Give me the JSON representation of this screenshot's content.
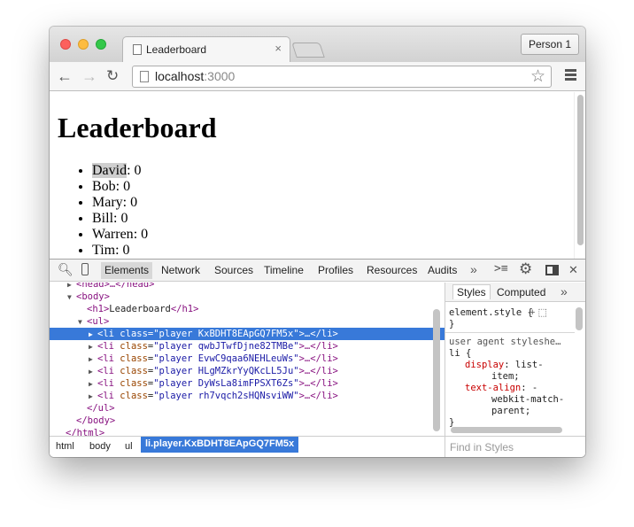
{
  "tab": {
    "title": "Leaderboard",
    "close": "×"
  },
  "profile": "Person 1",
  "omnibox": {
    "host": "localhost",
    "port": ":3000"
  },
  "page": {
    "heading": "Leaderboard",
    "players": [
      {
        "name": "David",
        "score": ": 0"
      },
      {
        "name": "Bob",
        "score": ": 0"
      },
      {
        "name": "Mary",
        "score": ": 0"
      },
      {
        "name": "Bill",
        "score": ": 0"
      },
      {
        "name": "Warren",
        "score": ": 0"
      },
      {
        "name": "Tim",
        "score": ": 0"
      }
    ]
  },
  "devtools": {
    "tabs": [
      "Elements",
      "Network",
      "Sources",
      "Timeline",
      "Profiles",
      "Resources",
      "Audits"
    ],
    "more": "»",
    "dom": {
      "head": "<head>…</head>",
      "body_open": "<body>",
      "h1_open": "<h1>",
      "h1_text": "Leaderboard",
      "h1_close": "</h1>",
      "ul_open": "<ul>",
      "li_open": "<li",
      "attr_name": "class",
      "li_tail": ">…</li>",
      "li_values": [
        "\"player KxBDHT8EApGQ7FM5x\"",
        "\"player qwbJTwfDjne82TMBe\"",
        "\"player EvwC9qaa6NEHLeuWs\"",
        "\"player HLgMZkrYyQKcLL5Ju\"",
        "\"player DyWsLa8imFPSXT6Zs\"",
        "\"player rh7vqch2sHQNsviWW\""
      ],
      "ul_close": "</ul>",
      "body_close": "</body>",
      "html_close": "</html>"
    },
    "styles": {
      "tabs": [
        "Styles",
        "Computed"
      ],
      "more": "»",
      "element_style": "element.style {",
      "close_brace": "}",
      "agent_label": "user agent styleshe…",
      "rule_open": "li {",
      "display_prop": "display",
      "display_val": ": list-",
      "display_cont": "item;",
      "align_prop": "text-align",
      "align_val": ": -",
      "align_cont1": "webkit-match-",
      "align_cont2": "parent;",
      "rule_close": "}",
      "find_placeholder": "Find in Styles"
    },
    "breadcrumbs": [
      "html",
      "body",
      "ul",
      "li.player.KxBDHT8EApGQ7FM5x"
    ]
  }
}
